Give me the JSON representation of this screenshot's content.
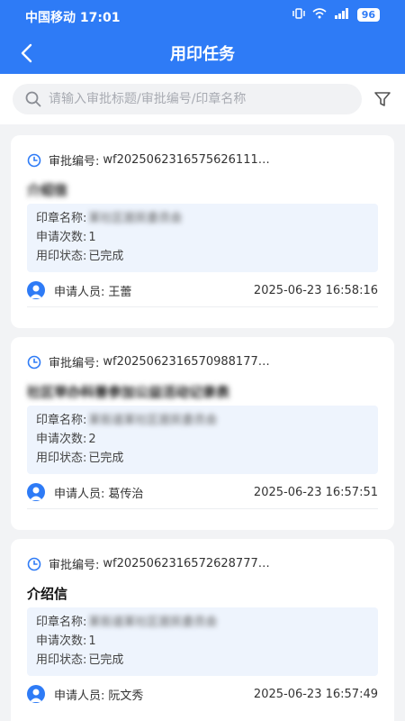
{
  "status_bar": {
    "carrier_time": "中国移动 17:01",
    "battery": "96"
  },
  "nav": {
    "title": "用印任务"
  },
  "search": {
    "placeholder": "请输入审批标题/审批编号/印章名称"
  },
  "labels": {
    "approval_no": "审批编号:",
    "seal_name": "印章名称:",
    "apply_count": "申请次数:",
    "seal_status": "用印状态:",
    "applicant": "申请人员:"
  },
  "tasks": [
    {
      "approval_no": "wf2025062316575626111…",
      "title": "介绍信",
      "seal_name": "某社区居民委员会",
      "apply_count": "1",
      "status": "已完成",
      "applicant": "王蕾",
      "time": "2025-06-23 16:58:16"
    },
    {
      "approval_no": "wf2025062316570988177…",
      "title": "社区举办科普参加公益活动记录表",
      "seal_name": "某街道某社区居民委员会",
      "apply_count": "2",
      "status": "已完成",
      "applicant": "葛传治",
      "time": "2025-06-23 16:57:51"
    },
    {
      "approval_no": "wf2025062316572628777…",
      "title": "介绍信",
      "seal_name": "某街道某社区居民委员会",
      "apply_count": "1",
      "status": "已完成",
      "applicant": "阮文秀",
      "time": "2025-06-23 16:57:49"
    }
  ],
  "colors": {
    "primary": "#2e7bf6",
    "info_bg": "#eef4fd",
    "page_bg": "#f2f3f5"
  }
}
